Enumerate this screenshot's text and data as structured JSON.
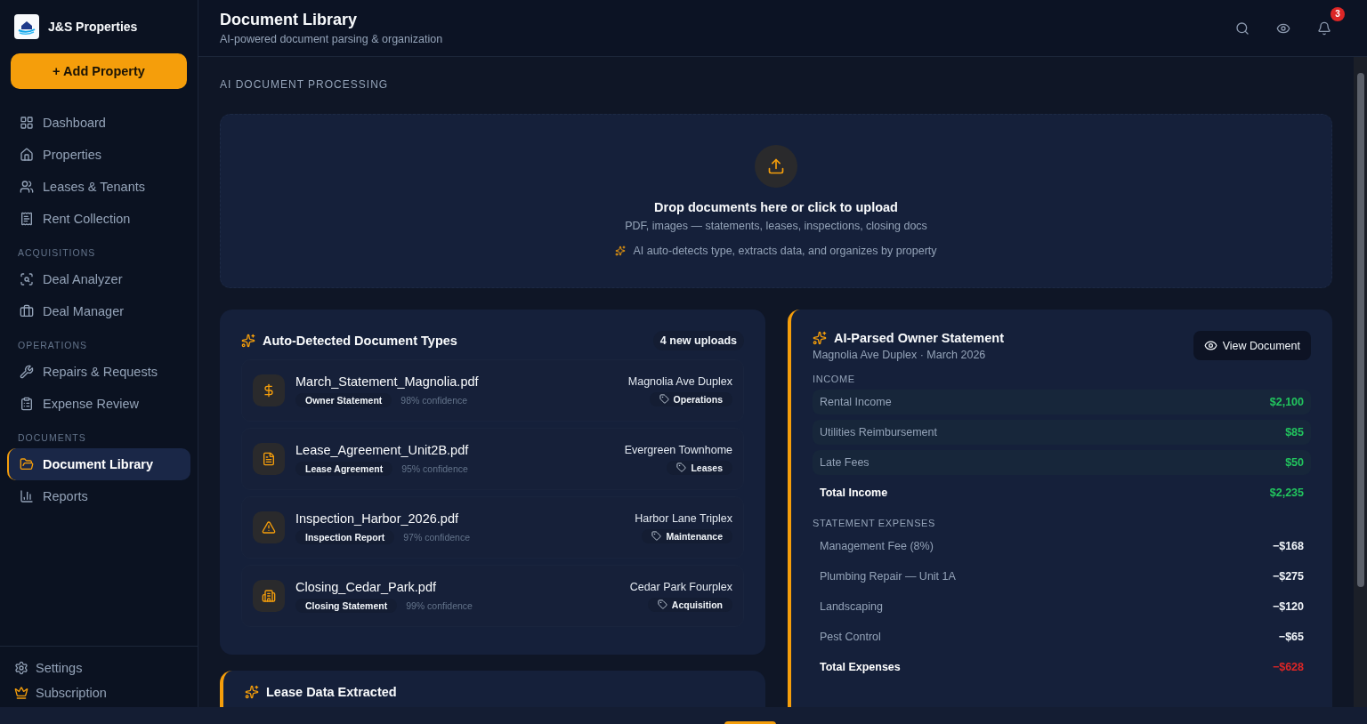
{
  "sidebar": {
    "brand": "J&S Properties",
    "add_button": "+ Add Property",
    "sections": [
      {
        "items": [
          {
            "label": "Dashboard",
            "selected": false
          },
          {
            "label": "Properties",
            "selected": false
          },
          {
            "label": "Leases & Tenants",
            "selected": false
          },
          {
            "label": "Rent Collection",
            "selected": false
          }
        ]
      },
      {
        "label": "ACQUISITIONS",
        "items": [
          {
            "label": "Deal Analyzer",
            "selected": false
          },
          {
            "label": "Deal Manager",
            "selected": false
          }
        ]
      },
      {
        "label": "OPERATIONS",
        "items": [
          {
            "label": "Repairs & Requests",
            "selected": false
          },
          {
            "label": "Expense Review",
            "selected": false
          }
        ]
      },
      {
        "label": "DOCUMENTS",
        "items": [
          {
            "label": "Document Library",
            "selected": true
          },
          {
            "label": "Reports",
            "selected": false
          }
        ]
      }
    ],
    "footer_items": [
      "Settings",
      "Subscription"
    ]
  },
  "header": {
    "title": "Document Library",
    "subtitle": "AI-powered document parsing & organization",
    "notification_count": "3"
  },
  "section_label": "AI DOCUMENT PROCESSING",
  "dropzone": {
    "title": "Drop documents here or click to upload",
    "formats": "PDF, images — statements, leases, inspections, closing docs",
    "note": "AI auto-detects type, extracts data, and organizes by property"
  },
  "detected": {
    "title": "Auto-Detected Document Types",
    "badge": "4 new uploads",
    "documents": [
      {
        "filename": "March_Statement_Magnolia.pdf",
        "doc_type": "Owner Statement",
        "confidence": "98% confidence",
        "property": "Magnolia Ave Duplex",
        "category": "Operations"
      },
      {
        "filename": "Lease_Agreement_Unit2B.pdf",
        "doc_type": "Lease Agreement",
        "confidence": "95% confidence",
        "property": "Evergreen Townhome",
        "category": "Leases"
      },
      {
        "filename": "Inspection_Harbor_2026.pdf",
        "doc_type": "Inspection Report",
        "confidence": "97% confidence",
        "property": "Harbor Lane Triplex",
        "category": "Maintenance"
      },
      {
        "filename": "Closing_Cedar_Park.pdf",
        "doc_type": "Closing Statement",
        "confidence": "99% confidence",
        "property": "Cedar Park Fourplex",
        "category": "Acquisition"
      }
    ]
  },
  "lease_card": {
    "title": "Lease Data Extracted"
  },
  "statement": {
    "title": "AI-Parsed Owner Statement",
    "subtitle": "Magnolia Ave Duplex · March 2026",
    "button": "View Document",
    "sections": [
      {
        "heading": "INCOME",
        "kind": "income",
        "rows": [
          {
            "label": "Rental Income",
            "amount": "$2,100",
            "kind": "item"
          },
          {
            "label": "Utilities Reimbursement",
            "amount": "$85",
            "kind": "item"
          },
          {
            "label": "Late Fees",
            "amount": "$50",
            "kind": "item"
          },
          {
            "label": "Total Income",
            "amount": "$2,235",
            "kind": "total"
          }
        ]
      },
      {
        "heading": "STATEMENT EXPENSES",
        "kind": "expense",
        "rows": [
          {
            "label": "Management Fee (8%)",
            "amount": "−$168",
            "kind": "item"
          },
          {
            "label": "Plumbing Repair — Unit 1A",
            "amount": "−$275",
            "kind": "item"
          },
          {
            "label": "Landscaping",
            "amount": "−$120",
            "kind": "item"
          },
          {
            "label": "Pest Control",
            "amount": "−$65",
            "kind": "item"
          },
          {
            "label": "Total Expenses",
            "amount": "−$628",
            "kind": "total"
          }
        ]
      }
    ]
  }
}
